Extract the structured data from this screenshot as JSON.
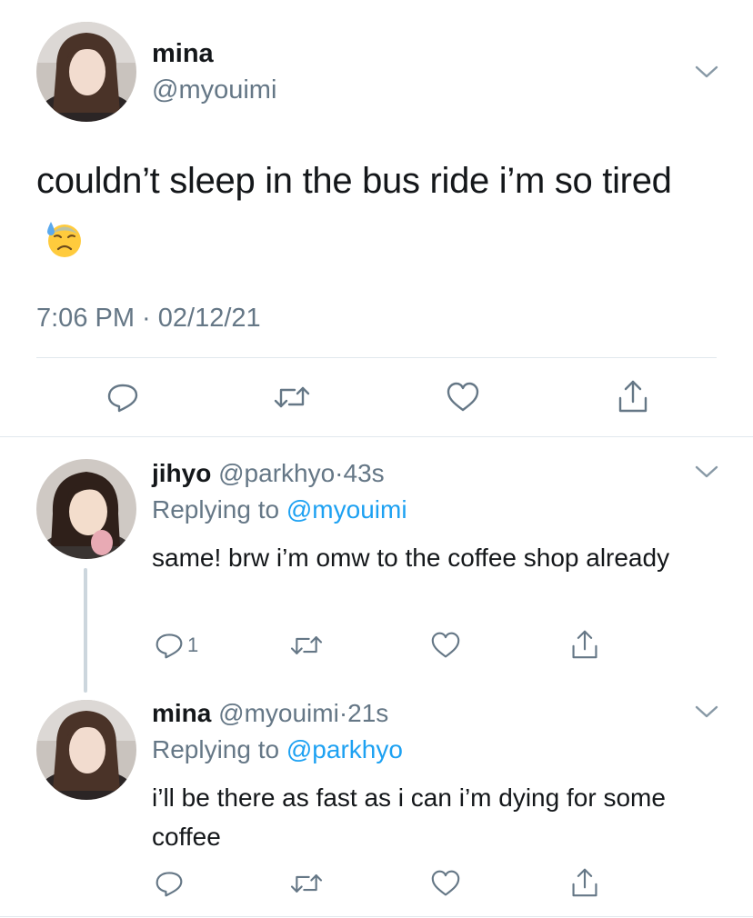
{
  "main_tweet": {
    "name": "mina",
    "handle": "@myouimi",
    "text": "couldn’t sleep in the bus ride i’m so tired",
    "emoji": "downcast-face-with-sweat",
    "timestamp": "7:06 PM · 02/12/21",
    "actions": [
      "reply-icon",
      "retweet-icon",
      "like-icon",
      "share-icon"
    ]
  },
  "replies": [
    {
      "name": "jihyo",
      "handle": "@parkhyo",
      "separator": "·",
      "time": "43s",
      "replying_prefix": "Replying to",
      "replying_to": "@myouimi",
      "text": "same! brw i’m omw to the coffee shop already",
      "reply_count": "1"
    },
    {
      "name": "mina",
      "handle": "@myouimi",
      "separator": "·",
      "time": "21s",
      "replying_prefix": "Replying to",
      "replying_to": "@parkhyo",
      "text": "i’ll be there as fast as i can i’m dying for some coffee",
      "reply_count": ""
    }
  ],
  "colors": {
    "text": "#14171a",
    "secondary": "#657786",
    "link": "#1da1f2",
    "divider": "#e1e8ed",
    "thread_line": "#ccd6dd"
  }
}
